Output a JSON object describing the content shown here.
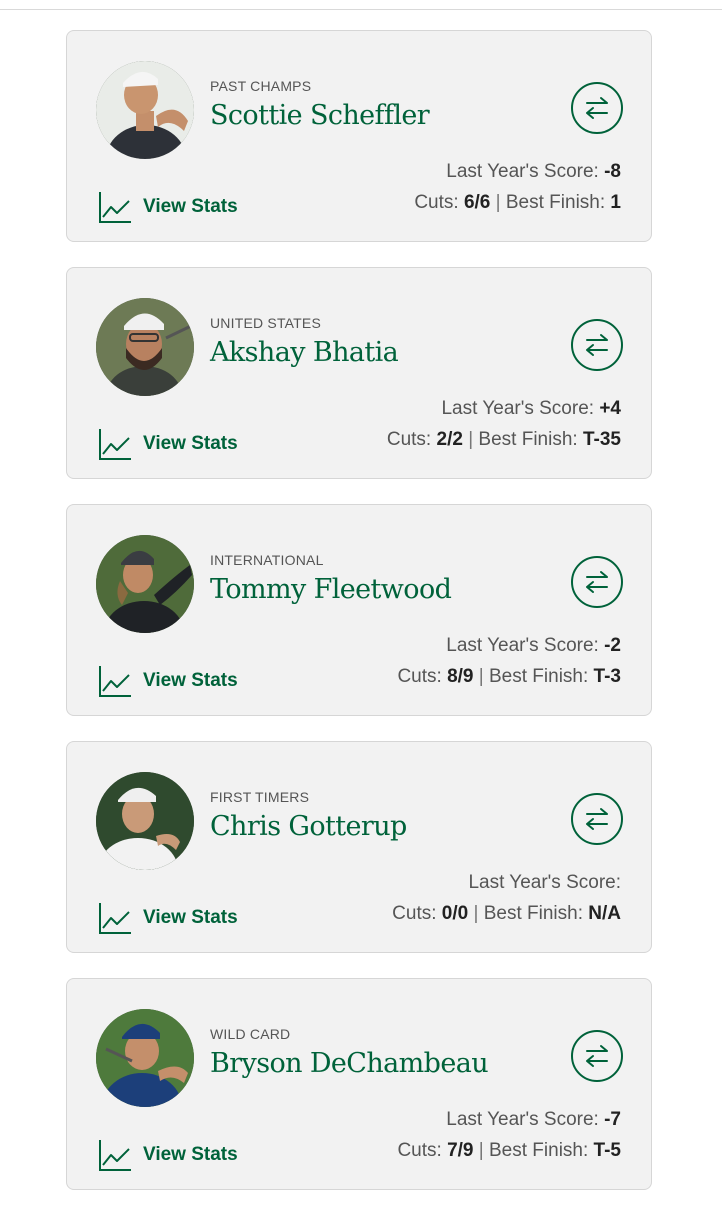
{
  "colors": {
    "accent": "#00623a",
    "card_bg": "#f2f2f2",
    "border": "#d6d6d6"
  },
  "players": [
    {
      "category": "PAST CHAMPS",
      "name": "Scottie Scheffler",
      "last_year_label": "Last Year's Score:",
      "last_year_score": "-8",
      "cuts_label": "Cuts:",
      "cuts": "6/6",
      "separator": "|",
      "best_finish_label": "Best Finish:",
      "best_finish": "1",
      "view_stats_label": "View Stats",
      "icons": {
        "stats": "line-chart-icon",
        "swap": "swap-arrows-icon"
      }
    },
    {
      "category": "UNITED STATES",
      "name": "Akshay Bhatia",
      "last_year_label": "Last Year's Score:",
      "last_year_score": "+4",
      "cuts_label": "Cuts:",
      "cuts": "2/2",
      "separator": "|",
      "best_finish_label": "Best Finish:",
      "best_finish": "T-35",
      "view_stats_label": "View Stats",
      "icons": {
        "stats": "line-chart-icon",
        "swap": "swap-arrows-icon"
      }
    },
    {
      "category": "INTERNATIONAL",
      "name": "Tommy Fleetwood",
      "last_year_label": "Last Year's Score:",
      "last_year_score": "-2",
      "cuts_label": "Cuts:",
      "cuts": "8/9",
      "separator": "|",
      "best_finish_label": "Best Finish:",
      "best_finish": "T-3",
      "view_stats_label": "View Stats",
      "icons": {
        "stats": "line-chart-icon",
        "swap": "swap-arrows-icon"
      }
    },
    {
      "category": "FIRST TIMERS",
      "name": "Chris Gotterup",
      "last_year_label": "Last Year's Score:",
      "last_year_score": "",
      "cuts_label": "Cuts:",
      "cuts": "0/0",
      "separator": "|",
      "best_finish_label": "Best Finish:",
      "best_finish": "N/A",
      "view_stats_label": "View Stats",
      "icons": {
        "stats": "line-chart-icon",
        "swap": "swap-arrows-icon"
      }
    },
    {
      "category": "WILD CARD",
      "name": "Bryson DeChambeau",
      "last_year_label": "Last Year's Score:",
      "last_year_score": "-7",
      "cuts_label": "Cuts:",
      "cuts": "7/9",
      "separator": "|",
      "best_finish_label": "Best Finish:",
      "best_finish": "T-5",
      "view_stats_label": "View Stats",
      "icons": {
        "stats": "line-chart-icon",
        "swap": "swap-arrows-icon"
      }
    }
  ]
}
